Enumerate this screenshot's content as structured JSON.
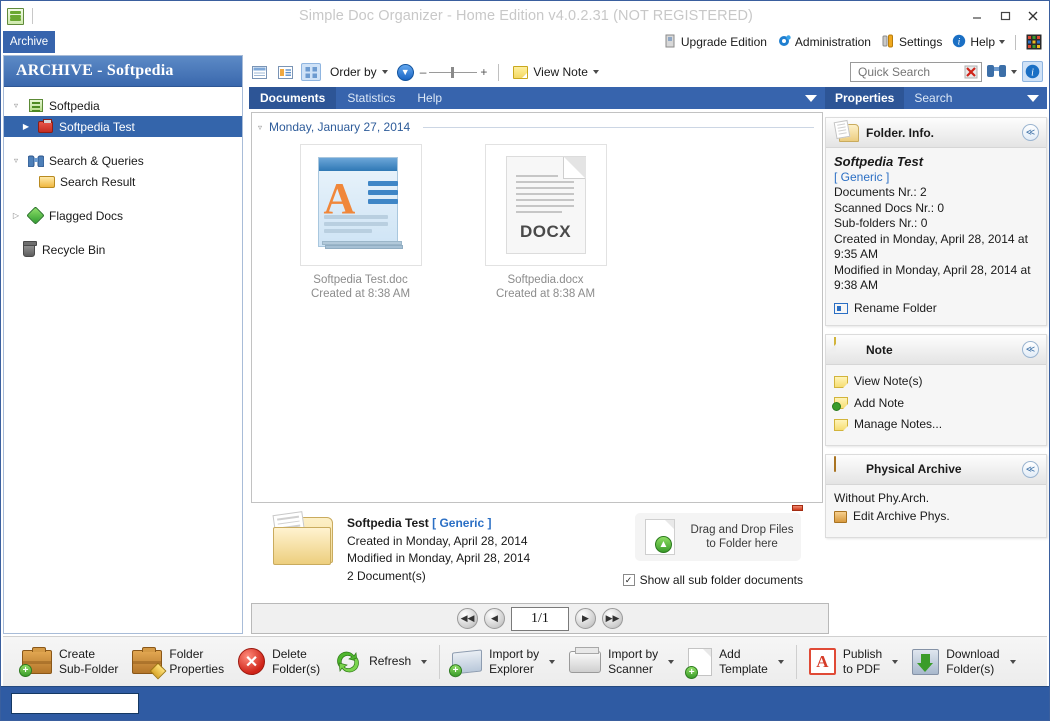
{
  "window": {
    "title": "Simple Doc Organizer - Home Edition v4.0.2.31 (NOT REGISTERED)",
    "app_icon": "document-stack-icon",
    "minimize_label": "–",
    "maximize_label": "❐",
    "close_label": "✕"
  },
  "menubar": {
    "archive_tab": "Archive",
    "right_items": [
      {
        "label": "Upgrade Edition",
        "icon": "upgrade-icon"
      },
      {
        "label": "Administration",
        "icon": "gear-blue-icon"
      },
      {
        "label": "Settings",
        "icon": "tools-icon"
      },
      {
        "label": "Help",
        "icon": "info-circle-icon",
        "has_caret": true
      }
    ],
    "grid_button_icon": "color-grid-icon"
  },
  "sidebar": {
    "header": "ARCHIVE - Softpedia",
    "items": [
      {
        "label": "Softpedia",
        "icon": "green-doc-icon",
        "expander": "▿",
        "indent": 0,
        "selected": false
      },
      {
        "label": "Softpedia Test",
        "icon": "red-case-icon",
        "expander": "▶",
        "indent": 1,
        "selected": true
      },
      {
        "label": "Search & Queries",
        "icon": "binoculars-icon",
        "expander": "▿",
        "indent": 0,
        "selected": false
      },
      {
        "label": "Search Result",
        "icon": "folder-search-icon",
        "expander": "",
        "indent": 2,
        "selected": false
      },
      {
        "label": "Flagged Docs",
        "icon": "green-diamond-icon",
        "expander": "▷",
        "indent": 0,
        "selected": false
      },
      {
        "label": "Recycle Bin",
        "icon": "recycle-bin-icon",
        "expander": "",
        "indent": 1,
        "selected": false
      }
    ]
  },
  "center_toolbar": {
    "view_list_icon": "list-view-icon",
    "view_details_icon": "details-view-icon",
    "view_tiles_icon": "tiles-view-icon",
    "order_by_label": "Order by",
    "sort_direction_icon": "sort-down-icon",
    "zoom_minus": "–",
    "zoom_plus": "+",
    "view_note_label": "View Note"
  },
  "quick_search": {
    "placeholder": "Quick Search",
    "value": "",
    "clear_icon": "clear-red-x-icon",
    "search_icon": "binoculars-icon",
    "info_icon": "info-circle-icon"
  },
  "center_tabs": [
    {
      "label": "Documents",
      "active": true
    },
    {
      "label": "Statistics",
      "active": false
    },
    {
      "label": "Help",
      "active": false
    }
  ],
  "documents": {
    "group_title": "Monday, January 27, 2014",
    "items": [
      {
        "name": "Softpedia Test.doc",
        "created": "Created at 8:38 AM",
        "icon": "wordpad-doc-icon"
      },
      {
        "name": "Softpedia.docx",
        "created": "Created at 8:38 AM",
        "icon": "docx-file-icon",
        "badge": "DOCX"
      }
    ]
  },
  "summary": {
    "folder_icon": "folder-documents-icon",
    "title": "Softpedia Test",
    "type": "[ Generic ]",
    "created": "Created in Monday, April 28, 2014",
    "modified": "Modified in Monday, April 28, 2014",
    "count": "2 Document(s)",
    "drop_zone_line1": "Drag and Drop Files",
    "drop_zone_line2": "to Folder here",
    "show_all_label": "Show all sub folder documents",
    "show_all_checked": true,
    "check_glyph": "✓"
  },
  "pager": {
    "first_glyph": "◀◀",
    "prev_glyph": "◀",
    "value": "1/1",
    "next_glyph": "▶",
    "last_glyph": "▶▶"
  },
  "right_panel": {
    "tabs": [
      {
        "label": "Properties",
        "active": true
      },
      {
        "label": "Search",
        "active": false
      }
    ],
    "cards": [
      {
        "id": "folder-info",
        "title": "Folder. Info.",
        "icon": "folder-info-icon",
        "collapse_glyph": "≪",
        "name": "Softpedia Test",
        "type": "[ Generic ]",
        "lines": [
          "Documents Nr.:  2",
          "Scanned Docs Nr.:  0",
          "Sub-folders Nr.:  0",
          "Created in Monday, April 28, 2014 at 9:35 AM",
          "Modified in Monday, April 28, 2014 at 9:38 AM"
        ],
        "action": "Rename Folder"
      },
      {
        "id": "note",
        "title": "Note",
        "icon": "note-icon",
        "collapse_glyph": "≪",
        "links": [
          {
            "label": "View Note(s)",
            "icon": "note-icon"
          },
          {
            "label": "Add Note",
            "icon": "note-add-icon"
          },
          {
            "label": "Manage Notes...",
            "icon": "note-icon"
          }
        ]
      },
      {
        "id": "physical-archive",
        "title": "Physical Archive",
        "icon": "crate-icon",
        "collapse_glyph": "≪",
        "status": "Without Phy.Arch.",
        "links": [
          {
            "label": "Edit Archive Phys.",
            "icon": "crate-small-icon"
          }
        ]
      }
    ]
  },
  "bottom_toolbar": [
    {
      "label": "Create\nSub-Folder",
      "icon": "briefcase-add-icon",
      "caret": false
    },
    {
      "label": "Folder\nProperties",
      "icon": "briefcase-edit-icon",
      "caret": false
    },
    {
      "label": "Delete\nFolder(s)",
      "icon": "delete-circle-icon",
      "caret": false
    },
    {
      "label": "Refresh",
      "icon": "refresh-icon",
      "caret": true
    },
    {
      "label": "Import by\nExplorer",
      "icon": "import-explorer-icon",
      "caret": true
    },
    {
      "label": "Import by\nScanner",
      "icon": "scanner-icon",
      "caret": true
    },
    {
      "label": "Add\nTemplate",
      "icon": "template-add-icon",
      "caret": true
    },
    {
      "label": "Publish\nto PDF",
      "icon": "pdf-icon",
      "caret": true
    },
    {
      "label": "Download\nFolder(s)",
      "icon": "download-icon",
      "caret": true
    }
  ],
  "statusbar": {
    "field_value": ""
  },
  "colors": {
    "accent_blue": "#3764ad",
    "sidebar_header_blue": "#3a68ad",
    "selection_blue": "#3465ab",
    "statusbar_blue": "#2f5ba3",
    "link_blue": "#2b6fc4",
    "muted_text": "#8c8c8c"
  }
}
